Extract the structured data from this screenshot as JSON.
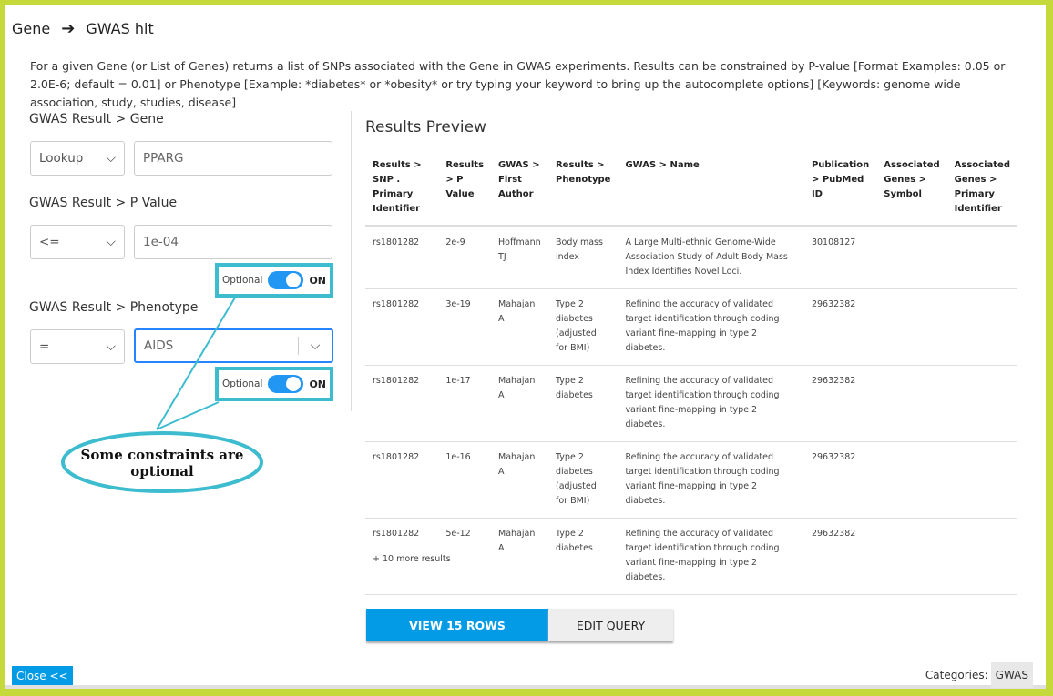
{
  "header": {
    "from": "Gene",
    "arrow_icon": "arrow-right-icon",
    "to": "GWAS hit"
  },
  "description": "For a given Gene (or List of Genes) returns a list of SNPs associated with the Gene in GWAS experiments. Results can be constrained by P-value [Format Examples: 0.05 or 2.0E-6; default = 0.01] or Phenotype [Example: *diabetes* or *obesity* or try typing your keyword to bring up the autocomplete options] [Keywords: genome wide association, study, studies, disease]",
  "constraints": [
    {
      "label": "GWAS Result > Gene",
      "operator": "Lookup",
      "value": "PPARG"
    },
    {
      "label": "GWAS Result > P Value",
      "operator": "<=",
      "value": "1e-04",
      "optional_label": "Optional",
      "toggle_state": "ON"
    },
    {
      "label": "GWAS Result > Phenotype",
      "operator": "=",
      "value": "AIDS",
      "optional_label": "Optional",
      "toggle_state": "ON"
    }
  ],
  "callout": "Some constraints are optional",
  "results": {
    "title": "Results Preview",
    "columns": [
      "Results > SNP . Primary Identifier",
      "Results > P Value",
      "GWAS > First Author",
      "Results > Phenotype",
      "GWAS > Name",
      "Publication > PubMed ID",
      "Associated Genes > Symbol",
      "Associated Genes > Primary Identifier"
    ],
    "rows": [
      [
        "rs1801282",
        "2e-9",
        "Hoffmann TJ",
        "Body mass index",
        "A Large Multi-ethnic Genome-Wide Association Study of Adult Body Mass Index Identifies Novel Loci.",
        "30108127",
        "",
        ""
      ],
      [
        "rs1801282",
        "3e-19",
        "Mahajan A",
        "Type 2 diabetes (adjusted for BMI)",
        "Refining the accuracy of validated target identification through coding variant fine-mapping in type 2 diabetes.",
        "29632382",
        "",
        ""
      ],
      [
        "rs1801282",
        "1e-17",
        "Mahajan A",
        "Type 2 diabetes",
        "Refining the accuracy of validated target identification through coding variant fine-mapping in type 2 diabetes.",
        "29632382",
        "",
        ""
      ],
      [
        "rs1801282",
        "1e-16",
        "Mahajan A",
        "Type 2 diabetes (adjusted for BMI)",
        "Refining the accuracy of validated target identification through coding variant fine-mapping in type 2 diabetes.",
        "29632382",
        "",
        ""
      ],
      [
        "rs1801282",
        "5e-12",
        "Mahajan A",
        "Type 2 diabetes",
        "Refining the accuracy of validated target identification through coding variant fine-mapping in type 2 diabetes.",
        "29632382",
        "",
        ""
      ]
    ],
    "more": "+ 10 more results"
  },
  "actions": {
    "view": "VIEW 15 ROWS",
    "edit": "EDIT QUERY"
  },
  "footer": {
    "close": "Close <<",
    "categories_label": "Categories:",
    "category": "GWAS"
  },
  "colors": {
    "accent": "#039be5",
    "toggle": "#2196f3",
    "callout": "#3dbcd0",
    "frame": "#c5d93a"
  }
}
